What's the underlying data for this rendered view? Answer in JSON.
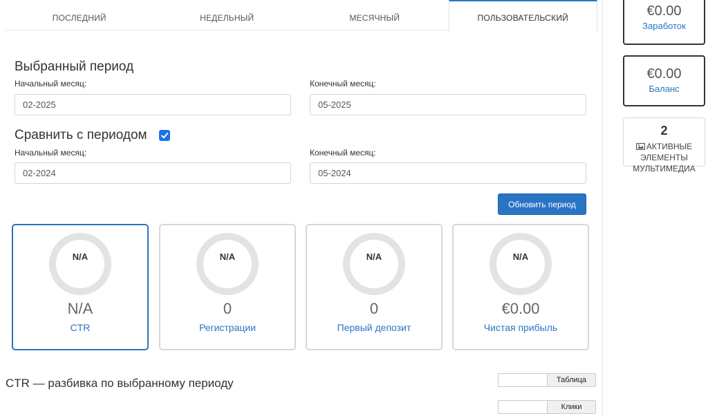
{
  "tabs": [
    {
      "label": "ПОСЛЕДНИЙ",
      "active": false
    },
    {
      "label": "НЕДЕЛЬНЫЙ",
      "active": false
    },
    {
      "label": "МЕСЯЧНЫЙ",
      "active": false
    },
    {
      "label": "ПОЛЬЗОВАТЕЛЬСКИЙ",
      "active": true
    }
  ],
  "selected_period": {
    "title": "Выбранный период",
    "start_label": "Начальный месяц:",
    "start_value": "02-2025",
    "end_label": "Конечный месяц:",
    "end_value": "05-2025"
  },
  "compare_period": {
    "title": "Сравнить с периодом",
    "checked": true,
    "start_label": "Начальный месяц:",
    "start_value": "02-2024",
    "end_label": "Конечный месяц:",
    "end_value": "05-2024"
  },
  "update_button": "Обновить период",
  "kpis": [
    {
      "ring": "N/A",
      "value": "N/A",
      "name": "CTR",
      "active": true
    },
    {
      "ring": "N/A",
      "value": "0",
      "name": "Регистрации",
      "active": false
    },
    {
      "ring": "N/A",
      "value": "0",
      "name": "Первый депозит",
      "active": false
    },
    {
      "ring": "N/A",
      "value": "€0.00",
      "name": "Чистая прибыль",
      "active": false
    }
  ],
  "breakdown": {
    "title": "CTR — разбивка по выбранному периоду",
    "view_toggle": "Таблица",
    "metric_toggle": "Клики"
  },
  "sidebar": {
    "earnings": {
      "amount": "€0.00",
      "label": "Заработок"
    },
    "balance": {
      "amount": "€0.00",
      "label": "Баланс"
    },
    "media": {
      "count": "2",
      "label": "АКТИВНЫЕ ЭЛЕМЕНТЫ МУЛЬТИМЕДИА"
    }
  },
  "colors": {
    "accent": "#2a74c4",
    "checkbox": "#1a73e8",
    "ring": "#e3e3e3"
  }
}
